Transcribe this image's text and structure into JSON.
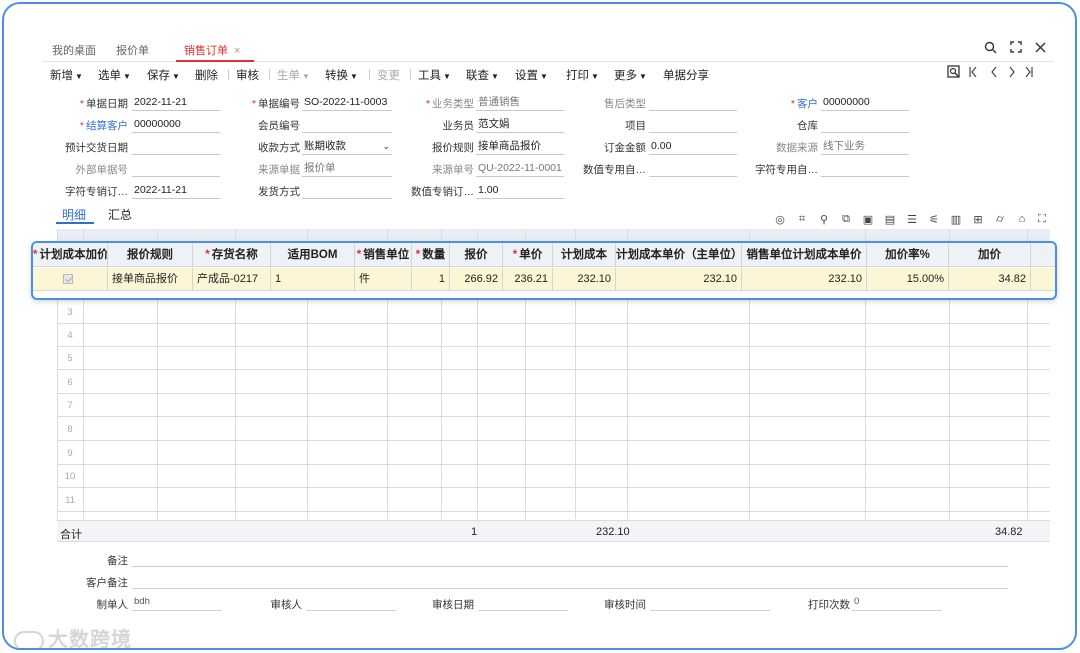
{
  "tabs": [
    {
      "label": "我的桌面"
    },
    {
      "label": "报价单"
    },
    {
      "label": "销售订单"
    }
  ],
  "tab_close_glyph": "×",
  "window_controls": {
    "search": "search-icon",
    "maximize": "maximize-icon",
    "close": "close-icon"
  },
  "toolbar": {
    "add": "新增",
    "select": "选单",
    "save": "保存",
    "delete": "删除",
    "audit": "审核",
    "generate": "生单",
    "convert": "转换",
    "change": "变更",
    "tools": "工具",
    "query": "联查",
    "settings": "设置",
    "print": "打印",
    "more": "更多",
    "share": "单据分享"
  },
  "form": {
    "doc_date": {
      "label": "单据日期",
      "value": "2022-11-21"
    },
    "doc_no": {
      "label": "单据编号",
      "value": "SO-2022-11-0003"
    },
    "biz_type": {
      "label": "业务类型",
      "value": "普通销售"
    },
    "aftersale_type": {
      "label": "售后类型",
      "value": ""
    },
    "customer": {
      "label": "客户",
      "value": "00000000"
    },
    "settle_customer": {
      "label": "结算客户",
      "value": "00000000"
    },
    "member_no": {
      "label": "会员编号",
      "value": ""
    },
    "salesman": {
      "label": "业务员",
      "value": "范文娟"
    },
    "project": {
      "label": "项目",
      "value": ""
    },
    "warehouse": {
      "label": "仓库",
      "value": ""
    },
    "delivery_date": {
      "label": "预计交货日期",
      "value": ""
    },
    "payment": {
      "label": "收款方式",
      "value": "账期收款"
    },
    "quote_rule": {
      "label": "报价规则",
      "value": "接单商品报价"
    },
    "deposit": {
      "label": "订金金额",
      "value": "0.00"
    },
    "data_source": {
      "label": "数据来源",
      "value": "线下业务"
    },
    "external_no": {
      "label": "外部单据号",
      "value": ""
    },
    "source_doc": {
      "label": "来源单据",
      "value": "报价单"
    },
    "source_no": {
      "label": "来源单号",
      "value": "QU-2022-11-0001"
    },
    "num_custom1": {
      "label": "数值专用自…",
      "value": ""
    },
    "char_custom1": {
      "label": "字符专用自…",
      "value": ""
    },
    "char_order": {
      "label": "字符专销订…",
      "value": "2022-11-21"
    },
    "ship_method": {
      "label": "发货方式",
      "value": ""
    },
    "num_order": {
      "label": "数值专销订…",
      "value": "1.00"
    }
  },
  "subtabs": [
    {
      "label": "明细"
    },
    {
      "label": "汇总"
    }
  ],
  "grid_icons": [
    "locate-icon",
    "scan-icon",
    "pin-icon",
    "copy-icon",
    "paste-icon",
    "doc-icon",
    "list-icon",
    "filter-icon",
    "chart-icon",
    "table-icon",
    "tag-icon",
    "warehouse-icon",
    "expand-icon"
  ],
  "grid": {
    "row_numbers": [
      "3",
      "4",
      "5",
      "6",
      "7",
      "8",
      "9",
      "10",
      "11"
    ]
  },
  "detail": {
    "headers": [
      "计划成本加价",
      "报价规则",
      "存货名称",
      "适用BOM",
      "销售单位",
      "数量",
      "报价",
      "单价",
      "计划成本",
      "计划成本单价（主单位）",
      "销售单位计划成本单价",
      "加价率%",
      "加价"
    ],
    "row": {
      "checked": true,
      "quote_rule": "接单商品报价",
      "item_name": "产成品-0217",
      "bom": "1",
      "unit": "件",
      "qty": "1",
      "quote": "266.92",
      "price": "236.21",
      "plan_cost": "232.10",
      "plan_unit_cost_main": "232.10",
      "plan_unit_cost_sale": "232.10",
      "markup_rate": "15.00%",
      "markup": "34.82"
    }
  },
  "totals": {
    "label": "合计",
    "qty": "1",
    "plan_cost": "232.10",
    "markup": "34.82"
  },
  "footer": {
    "remark": {
      "label": "备注"
    },
    "customer_remark": {
      "label": "客户备注"
    },
    "creator": {
      "label": "制单人",
      "value": "bdh"
    },
    "auditor": {
      "label": "审核人"
    },
    "audit_date": {
      "label": "审核日期"
    },
    "audit_time": {
      "label": "审核时间"
    },
    "print_count": {
      "label": "打印次数",
      "value": "0"
    }
  },
  "watermark": "大数跨境",
  "colors": {
    "accent_red": "#e03030",
    "accent_blue": "#4a90e2",
    "row_highlight": "#fdf6d6"
  }
}
